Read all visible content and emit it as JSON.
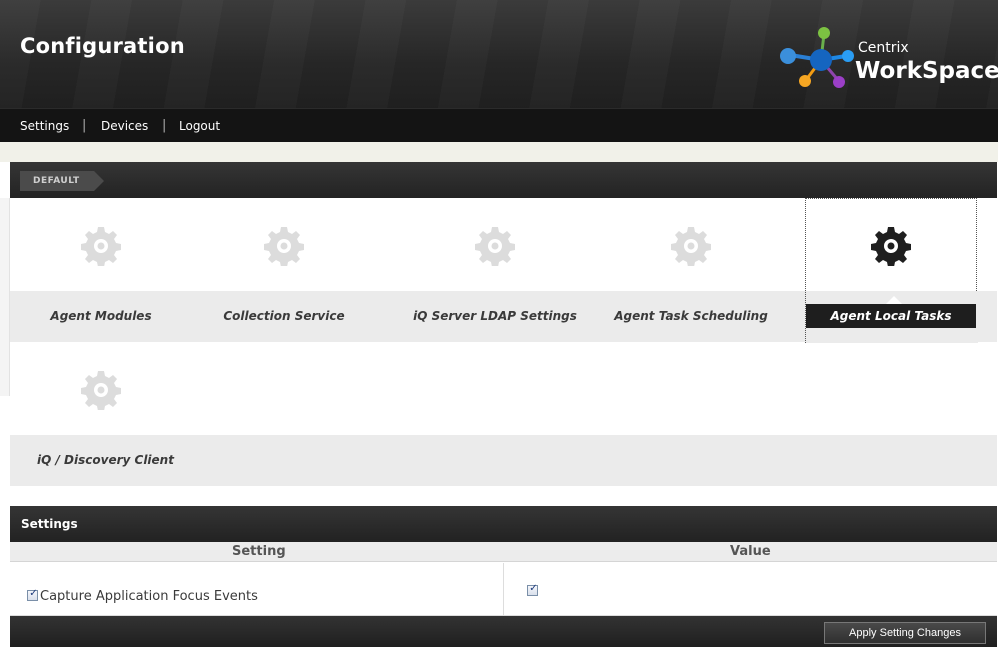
{
  "header": {
    "title": "Configuration",
    "logo": {
      "small": "Centrix",
      "big": "WorkSpace"
    }
  },
  "nav": [
    {
      "label": "Settings"
    },
    {
      "label": "Devices"
    },
    {
      "label": "Logout"
    }
  ],
  "breadcrumb": "DEFAULT",
  "modules": [
    {
      "label": "Agent Modules",
      "active": false
    },
    {
      "label": "Collection Service",
      "active": false
    },
    {
      "label": "iQ Server LDAP Settings",
      "active": false
    },
    {
      "label": "Agent Task Scheduling",
      "active": false
    },
    {
      "label": "Agent Local Tasks",
      "active": true
    },
    {
      "label": "iQ / Discovery Client",
      "active": false
    }
  ],
  "settings": {
    "title": "Settings",
    "columns": [
      "Setting",
      "Value"
    ],
    "rows": [
      {
        "setting": "Capture Application Focus Events",
        "setting_checked": true,
        "value_checked": true
      }
    ],
    "apply_label": "Apply Setting Changes"
  },
  "colors": {
    "header_dark": "#1a1a1a",
    "active_label": "#1e1e1e",
    "gear_inactive": "#dcdcdc",
    "gear_active": "#1f1f1f"
  }
}
